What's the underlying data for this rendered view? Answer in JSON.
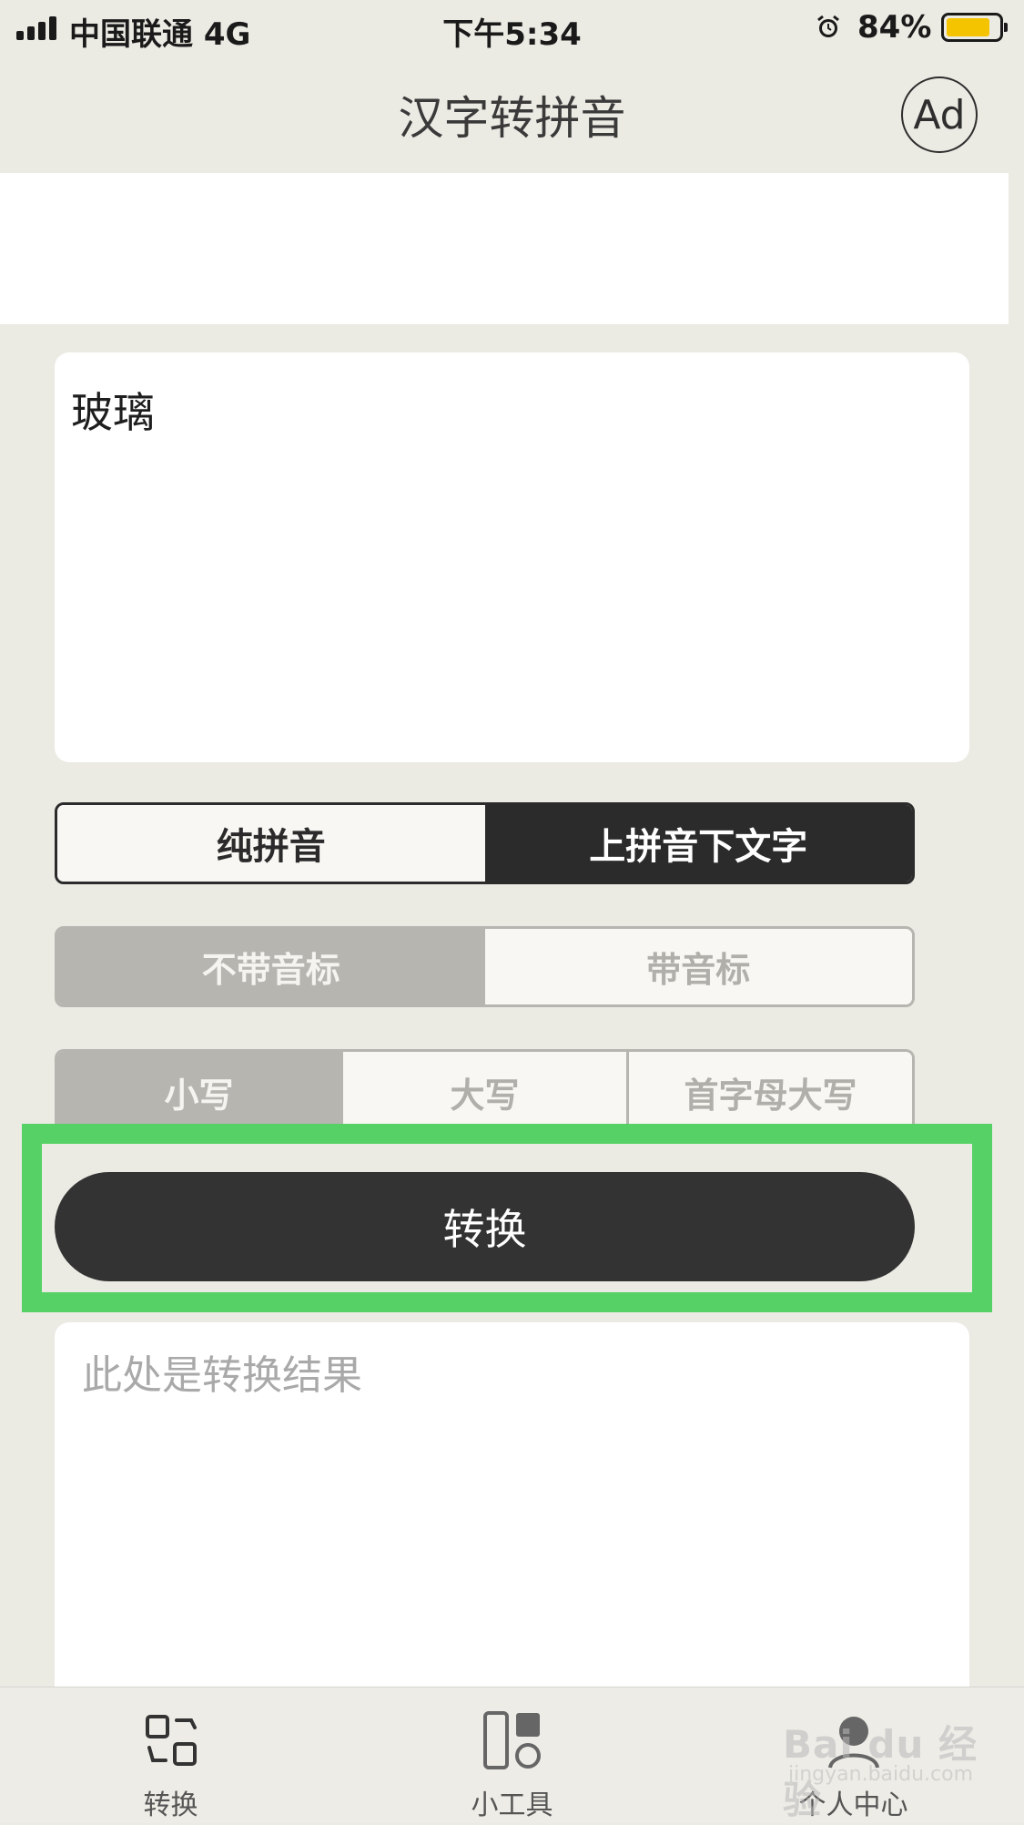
{
  "status_bar": {
    "carrier": "中国联通  4G",
    "time": "下午5:34",
    "battery_percent_label": "84%",
    "battery_level": 0.84
  },
  "nav": {
    "title": "汉字转拼音",
    "ad_label": "Ad"
  },
  "input": {
    "value": "玻璃"
  },
  "mode_options": [
    "纯拼音",
    "上拼音下文字"
  ],
  "mode_selected": 1,
  "tone_options": [
    "不带音标",
    "带音标"
  ],
  "tone_selected": 0,
  "case_options": [
    "小写",
    "大写",
    "首字母大写"
  ],
  "case_selected": 0,
  "convert_button": {
    "label": "转换"
  },
  "output": {
    "placeholder": "此处是转换结果"
  },
  "tab_bar": {
    "items": [
      {
        "label": "转换",
        "icon": "convert-icon"
      },
      {
        "label": "小工具",
        "icon": "tools-icon"
      },
      {
        "label": "个人中心",
        "icon": "profile-icon"
      }
    ],
    "active": 0
  },
  "watermark": {
    "text": "Bai du 经验",
    "sub": "jingyan.baidu.com"
  },
  "colors": {
    "background": "#ebeae3",
    "dark": "#2b2b2b",
    "muted": "#b6b5b0",
    "highlight": "#55d166",
    "battery": "#f5c400"
  }
}
